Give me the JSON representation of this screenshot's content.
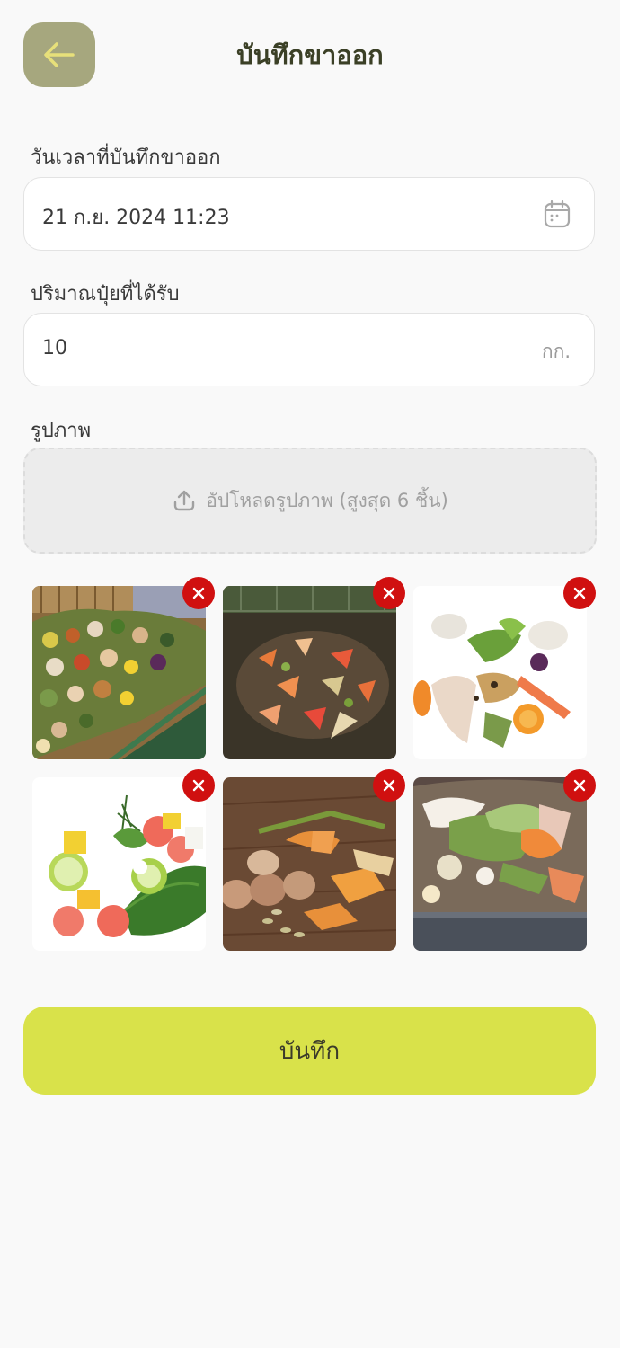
{
  "header": {
    "title": "บันทึกขาออก",
    "back_icon": "arrow-left-icon"
  },
  "form": {
    "date_label": "วันเวลาที่บันทึกขาออก",
    "date_value": "21 ก.ย. 2024 11:23",
    "date_icon": "calendar-icon",
    "amount_label": "ปริมาณปุ๋ยที่ได้รับ",
    "amount_value": "10",
    "amount_unit": "กก.",
    "photo_label": "รูปภาพ",
    "upload_label": "อัปโหลดรูปภาพ (สูงสุด 6 ชิ้น)",
    "upload_icon": "upload-icon"
  },
  "photos": [
    {
      "subject": "vegetables-in-green-bin"
    },
    {
      "subject": "compost-pile"
    },
    {
      "subject": "food-scraps-white"
    },
    {
      "subject": "fruit-salad-scraps"
    },
    {
      "subject": "eggshells-on-wood"
    },
    {
      "subject": "food-scraps-in-tub"
    }
  ],
  "save_button": {
    "label": "บันทึก"
  },
  "colors": {
    "back_button": "#a6a77e",
    "back_arrow": "#e7e07a",
    "save_button": "#d9e24a",
    "remove_button": "#d01010",
    "title": "#3b4026"
  }
}
